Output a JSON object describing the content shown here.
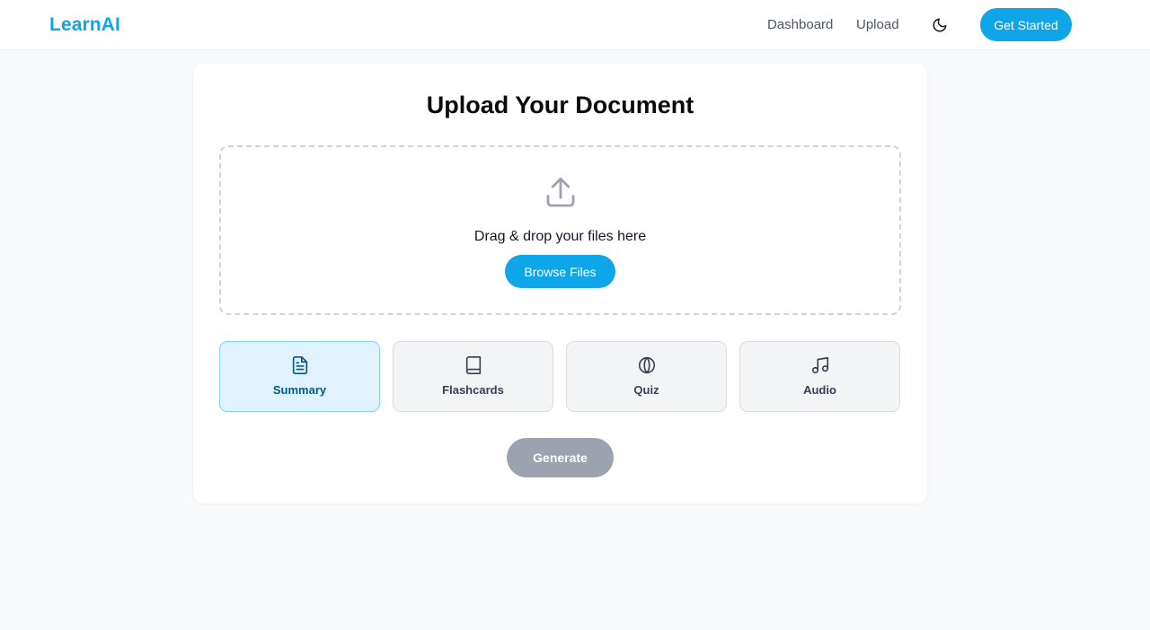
{
  "header": {
    "brand": "LearnAI",
    "nav": [
      {
        "label": "Dashboard"
      },
      {
        "label": "Upload"
      }
    ],
    "theme_toggle_icon": "moon-icon",
    "cta_label": "Get Started"
  },
  "upload": {
    "title": "Upload Your Document",
    "dropzone": {
      "icon": "upload-icon",
      "text": "Drag & drop your files here",
      "browse_label": "Browse Files"
    },
    "options": [
      {
        "label": "Summary",
        "icon": "document-icon",
        "selected": true
      },
      {
        "label": "Flashcards",
        "icon": "book-icon",
        "selected": false
      },
      {
        "label": "Quiz",
        "icon": "brain-icon",
        "selected": false
      },
      {
        "label": "Audio",
        "icon": "music-note-icon",
        "selected": false
      }
    ],
    "generate_label": "Generate",
    "generate_disabled": true
  },
  "colors": {
    "accent": "#0ea5e9",
    "selected_bg": "#e0f2fe",
    "selected_border": "#7dd3fc",
    "disabled_button": "#9ca3af",
    "page_background": "#f8f9fb"
  }
}
